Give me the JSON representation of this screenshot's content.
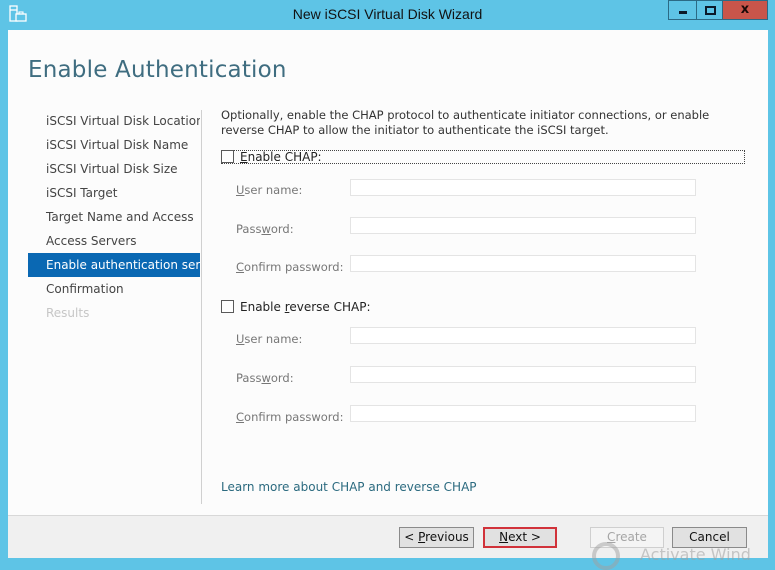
{
  "window": {
    "title": "New iSCSI Virtual Disk Wizard",
    "icon": "server-briefcase-icon",
    "controls": {
      "minimize": "minimize-icon",
      "maximize": "maximize-icon",
      "close": "x"
    }
  },
  "page": {
    "heading": "Enable Authentication"
  },
  "nav": {
    "items": [
      {
        "label": "iSCSI Virtual Disk Location",
        "state": "normal"
      },
      {
        "label": "iSCSI Virtual Disk Name",
        "state": "normal"
      },
      {
        "label": "iSCSI Virtual Disk Size",
        "state": "normal"
      },
      {
        "label": "iSCSI Target",
        "state": "normal"
      },
      {
        "label": "Target Name and Access",
        "state": "normal"
      },
      {
        "label": "Access Servers",
        "state": "normal"
      },
      {
        "label": "Enable authentication ser...",
        "state": "active"
      },
      {
        "label": "Confirmation",
        "state": "normal"
      },
      {
        "label": "Results",
        "state": "disabled"
      }
    ]
  },
  "content": {
    "description": "Optionally, enable the CHAP protocol to authenticate initiator connections, or enable reverse CHAP to allow the initiator to authenticate the iSCSI target.",
    "chap": {
      "checkbox_label_accel": "E",
      "checkbox_label_rest": "nable CHAP:",
      "checked": false,
      "fields": [
        {
          "accel": "U",
          "rest": "ser name:",
          "pre": "",
          "value": ""
        },
        {
          "pre": "Pass",
          "accel": "w",
          "rest": "ord:",
          "value": ""
        },
        {
          "accel": "C",
          "rest": "onfirm password:",
          "pre": "",
          "value": ""
        }
      ]
    },
    "reverse_chap": {
      "checkbox_label_pre": "Enable ",
      "checkbox_label_accel": "r",
      "checkbox_label_rest": "everse CHAP:",
      "checked": false,
      "fields": [
        {
          "accel": "U",
          "rest": "ser name:",
          "pre": "",
          "value": ""
        },
        {
          "pre": "Pass",
          "accel": "w",
          "rest": "ord:",
          "value": ""
        },
        {
          "accel": "C",
          "rest": "onfirm password:",
          "pre": "",
          "value": ""
        }
      ]
    },
    "learn_more_link": "Learn more about CHAP and reverse CHAP"
  },
  "footer": {
    "previous": {
      "pre": "< ",
      "accel": "P",
      "rest": "revious"
    },
    "next": {
      "pre": "",
      "accel": "N",
      "rest": "ext >"
    },
    "create": {
      "pre": "",
      "accel": "C",
      "rest": "reate"
    },
    "cancel": "Cancel"
  },
  "watermark": "Activate Wind",
  "colors": {
    "titlebar": "#5ec4e6",
    "close_button": "#c9554a",
    "nav_active": "#0a68b3",
    "heading": "#3f6d80",
    "highlight_border": "#d1323a"
  }
}
